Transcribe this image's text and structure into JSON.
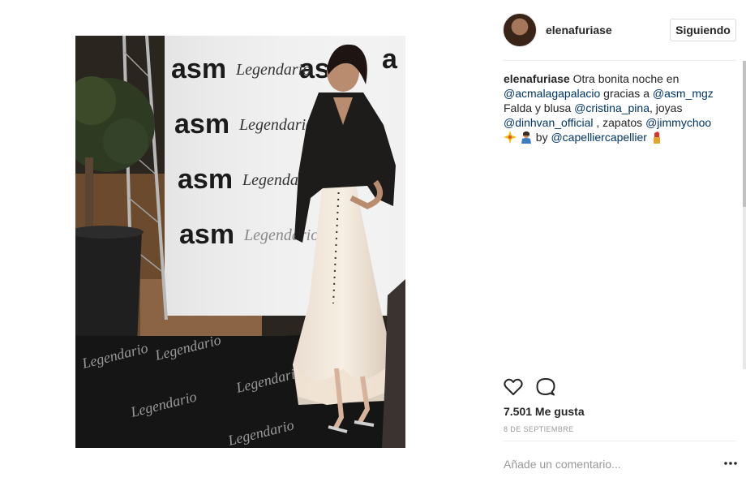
{
  "post": {
    "photo_alt": "",
    "backdrop": {
      "brand_primary": "asm",
      "brand_secondary": "Legendario",
      "carpet_text": "Legendario"
    }
  },
  "header": {
    "username": "elenafuriase",
    "follow_label": "Siguiendo"
  },
  "caption": {
    "username": "elenafuriase",
    "text_1": " Otra bonita noche en ",
    "mention_1": "@acmalagapalacio",
    "text_2": " gracias a ",
    "mention_2": "@asm_mgz",
    "text_3": " Falda y blusa ",
    "mention_3": "@cristina_pina",
    "text_4": ", joyas ",
    "mention_4": "@dinhvan_official",
    "text_5": " , zapatos ",
    "mention_5": "@jimmychoo",
    "text_6": " by ",
    "mention_6": "@capelliercapellier"
  },
  "actions": {
    "like_icon": "heart-icon",
    "comment_icon": "comment-bubble-icon"
  },
  "likes": "7.501 Me gusta",
  "date": "8 DE SEPTIEMBRE",
  "comment": {
    "placeholder": "Añade un comentario...",
    "more_icon": "more-options-icon"
  },
  "colors": {
    "link": "#003569",
    "text": "#262626",
    "muted": "#999999",
    "border": "#dbdbdb"
  }
}
